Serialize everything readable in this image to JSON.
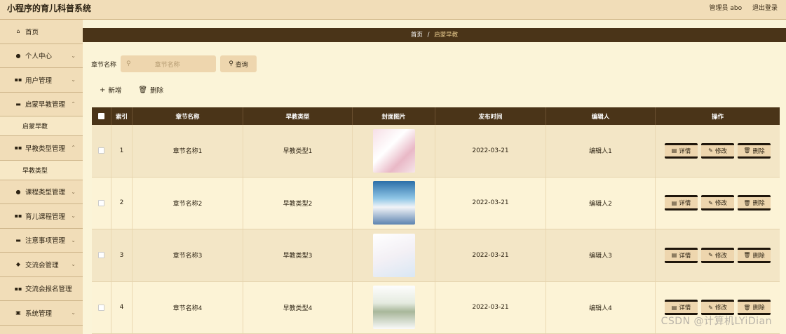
{
  "app": {
    "title": "小程序的育儿科普系统",
    "admin_label": "管理员 abo",
    "logout_label": "退出登录"
  },
  "sidebar": {
    "items": [
      {
        "label": "首页",
        "icon": "home-icon"
      },
      {
        "label": "个人中心",
        "icon": "user-icon"
      },
      {
        "label": "用户管理",
        "icon": "grid-icon"
      },
      {
        "label": "启蒙早教管理",
        "icon": "book-icon"
      },
      {
        "label": "启蒙早教",
        "sub": true
      },
      {
        "label": "早教类型管理",
        "icon": "grid-icon"
      },
      {
        "label": "早教类型",
        "sub": true
      },
      {
        "label": "课程类型管理",
        "icon": "user-icon"
      },
      {
        "label": "育儿课程管理",
        "icon": "grid-icon"
      },
      {
        "label": "注意事项管理",
        "icon": "note-icon"
      },
      {
        "label": "交流会管理",
        "icon": "chat-icon"
      },
      {
        "label": "交流会报名管理",
        "icon": "grid-icon"
      },
      {
        "label": "系统管理",
        "icon": "gear-icon"
      }
    ]
  },
  "breadcrumb": {
    "home": "首页",
    "separator": "/",
    "current": "启蒙早教"
  },
  "search": {
    "label": "章节名称",
    "placeholder": "章节名称",
    "button_label": "查询"
  },
  "toolbar": {
    "add_label": "新增",
    "delete_label": "删除"
  },
  "table": {
    "columns": [
      "索引",
      "章节名称",
      "早教类型",
      "封面图片",
      "发布时间",
      "编辑人",
      "操作"
    ],
    "rows": [
      {
        "index": "1",
        "name": "章节名称1",
        "type": "早教类型1",
        "date": "2022-03-21",
        "author": "编辑人1"
      },
      {
        "index": "2",
        "name": "章节名称2",
        "type": "早教类型2",
        "date": "2022-03-21",
        "author": "编辑人2"
      },
      {
        "index": "3",
        "name": "章节名称3",
        "type": "早教类型3",
        "date": "2022-03-21",
        "author": "编辑人3"
      },
      {
        "index": "4",
        "name": "章节名称4",
        "type": "早教类型4",
        "date": "2022-03-21",
        "author": "编辑人4"
      }
    ],
    "actions": {
      "detail": "详情",
      "edit": "修改",
      "delete": "删除"
    }
  },
  "watermark": "CSDN @计算机LYiDian"
}
